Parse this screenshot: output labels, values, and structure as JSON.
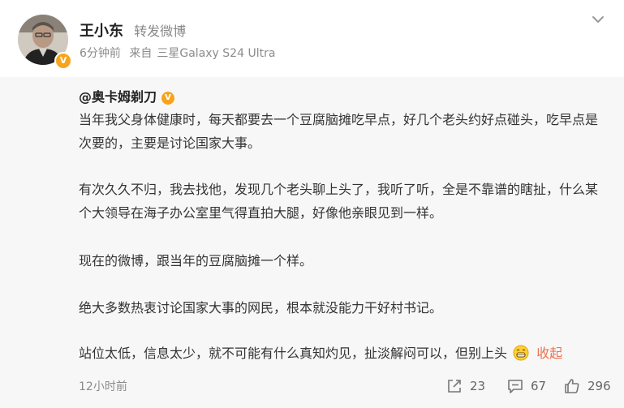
{
  "post": {
    "author": "王小东",
    "action": "转发微博",
    "time": "6分钟前",
    "source_prefix": "来自",
    "source": "三星Galaxy S24 Ultra"
  },
  "repost": {
    "author": "@奥卡姆剃刀",
    "paragraphs": [
      "当年我父身体健康时，每天都要去一个豆腐脑摊吃早点，好几个老头约好点碰头，吃早点是次要的，主要是讨论国家大事。",
      "有次久久不归，我去找他，发现几个老头聊上头了，我听了听，全是不靠谱的瞎扯，什么某个大领导在海子办公室里气得直拍大腿，好像他亲眼见到一样。",
      "现在的微博，跟当年的豆腐脑摊一个样。",
      "绝大多数热衷讨论国家大事的网民，根本就没能力干好村书记。",
      "站位太低，信息太少，就不可能有什么真知灼见，扯淡解闷可以，但别上头"
    ],
    "collapse_label": "收起",
    "time": "12小时前",
    "reposts": "23",
    "comments": "67",
    "likes": "296"
  },
  "colors": {
    "verified_badge": "#f7a41d",
    "collapse_link": "#eb7350",
    "repost_bg": "#f7f7f7"
  },
  "icons": [
    "avatar",
    "verified-badge-icon",
    "chevron-down-icon",
    "grin-emoji-icon",
    "repost-icon",
    "comment-icon",
    "like-icon"
  ]
}
